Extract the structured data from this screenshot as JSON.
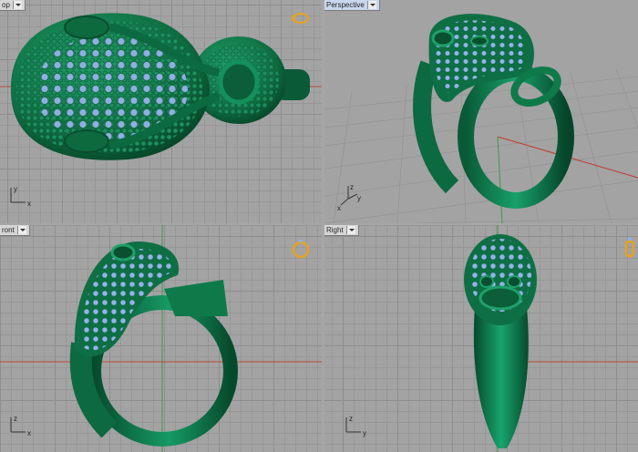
{
  "viewports": {
    "top": {
      "label": "op",
      "axes": {
        "a": "y",
        "b": "x"
      }
    },
    "perspective": {
      "label": "Perspective",
      "axes": {
        "a": "z",
        "b": "y",
        "c": "x"
      }
    },
    "front": {
      "label": "ront",
      "axes": {
        "a": "z",
        "b": "x"
      }
    },
    "right": {
      "label": "Right",
      "axes": {
        "a": "z",
        "b": "y"
      }
    }
  },
  "icons": {
    "dropdown": "chevron-down-icon",
    "gizmo": "ring-orientation-icon"
  },
  "colors": {
    "model_green": "#0f7a4a",
    "gem_blue": "#8fb0e8",
    "x_axis": "#c23a2a",
    "y_axis": "#3f9a3f",
    "gizmo_gold": "#e8a21e"
  }
}
